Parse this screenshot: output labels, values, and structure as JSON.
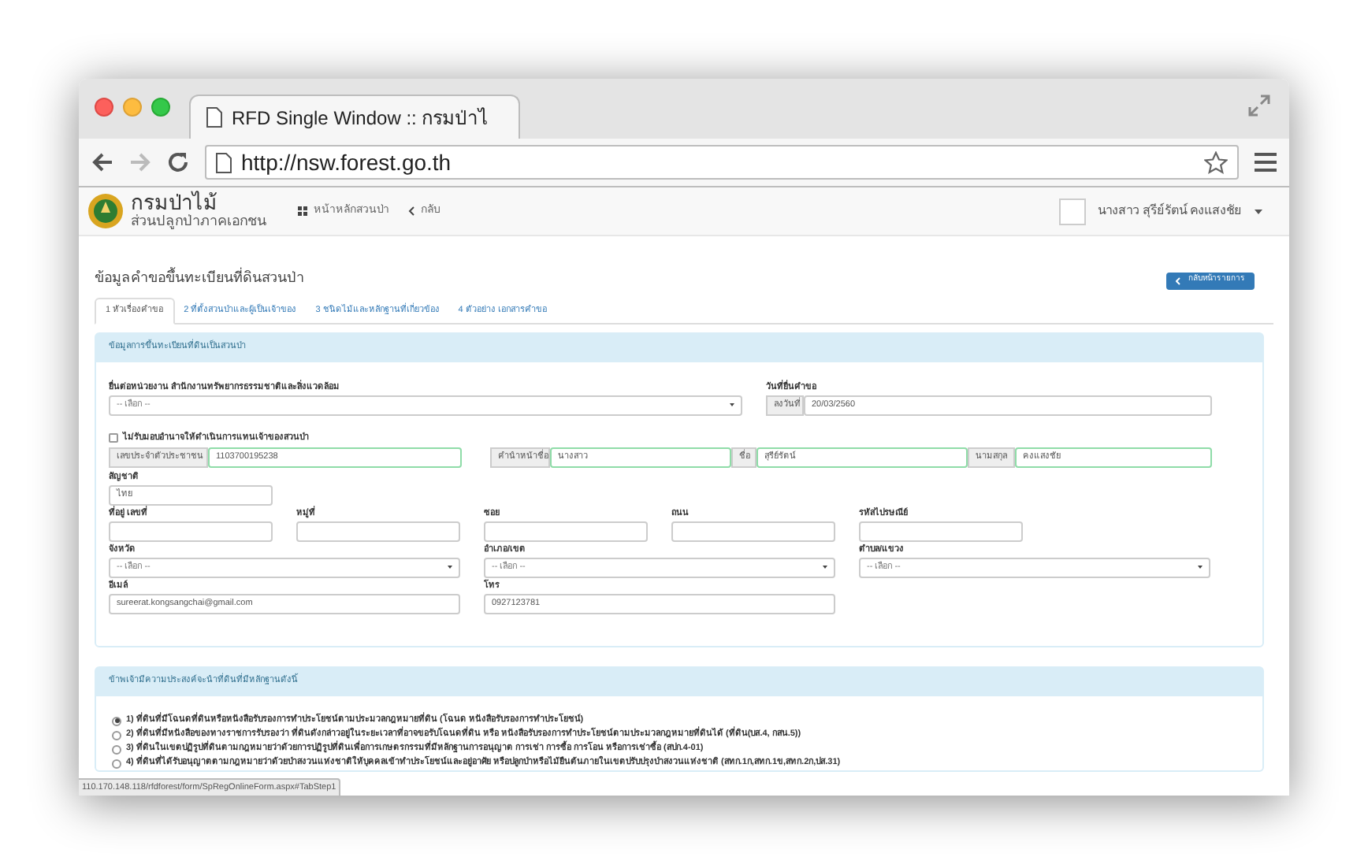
{
  "browser": {
    "tab_title": "RFD Single Window :: กรมป่าไ",
    "url": "http://nsw.forest.go.th"
  },
  "navbar": {
    "org_name": "กรมป่าไม้",
    "org_subtitle": "ส่วนปลูกป่าภาคเอกชน",
    "links": [
      "หน้าหลักสวนป่า",
      "กลับ"
    ],
    "user_name": "นางสาว สุรีย์รัตน์ คงแสงชัย"
  },
  "page": {
    "heading": "ข้อมูลคำขอขึ้นทะเบียนที่ดินสวนป่า",
    "back_button": "กลับหน้ารายการ"
  },
  "tabs": [
    {
      "label": "1 หัวเรื่องคำขอ",
      "selected": true
    },
    {
      "label": "2 ที่ตั้งสวนป่าและผู้เป็นเจ้าของ",
      "selected": false
    },
    {
      "label": "3 ชนิดไม้และหลักฐานที่เกี่ยวข้อง",
      "selected": false
    },
    {
      "label": "4 ตัวอย่าง เอกสารคำขอ",
      "selected": false
    }
  ],
  "registration_panel": {
    "title": "ข้อมูลการขึ้นทะเบียนที่ดินเป็นสวนป่า",
    "agency": {
      "label": "ยื่นต่อหน่วยงาน สำนักงานทรัพยากรธรรมชาติและสิ่งแวดล้อม",
      "value": "-- เลือก --"
    },
    "submit_date": {
      "label": "วันที่ยื่นคำขอ",
      "addon": "ลงวันที่",
      "value": "20/03/2560"
    },
    "proxy_checkbox": {
      "label": "ไม่รับมอบอำนาจให้ดำเนินการแทนเจ้าของสวนป่า",
      "checked": false
    },
    "identity": [
      {
        "addon": "เลขประจำตัวประชาชน",
        "value": "1103700195238",
        "valid": true
      },
      {
        "addon": "คำนำหน้าชื่อ",
        "value": "นางสาว",
        "valid": true
      },
      {
        "addon": "ชื่อ",
        "value": "สุรีย์รัตน์",
        "valid": true
      },
      {
        "addon": "นามสกุล",
        "value": "คงแสงชัย",
        "valid": true
      }
    ],
    "nationality": {
      "label": "สัญชาติ",
      "value": "ไทย"
    },
    "address": [
      {
        "label": "ที่อยู่ เลขที่"
      },
      {
        "label": "หมู่ที่"
      },
      {
        "label": "ซอย"
      },
      {
        "label": "ถนน"
      },
      {
        "label": "รหัสไปรษณีย์"
      }
    ],
    "location": [
      {
        "label": "จังหวัด",
        "value": "-- เลือก --"
      },
      {
        "label": "อำเภอ/เขต",
        "value": "-- เลือก --"
      },
      {
        "label": "ตำบล/แขวง",
        "value": "-- เลือก --"
      }
    ],
    "contact": [
      {
        "label": "อีเมล์",
        "value": "sureerat.kongsangchai@gmail.com"
      },
      {
        "label": "โทร",
        "value": "0927123781"
      }
    ]
  },
  "evidence_panel": {
    "title": "ข้าพเจ้ามีความประสงค์จะนำที่ดินที่มีหลักฐานดังนี้",
    "options": [
      {
        "label": "1) ที่ดินที่มีโฉนดที่ดินหรือหนังสือรับรองการทำประโยชน์ตามประมวลกฎหมายที่ดิน (โฉนด หนังสือรับรองการทำประโยชน์)",
        "selected": true
      },
      {
        "label": "2) ที่ดินที่มีหนังสือของทางราชการรับรองว่า ที่ดินดังกล่าวอยู่ในระยะเวลาที่อาจขอรับโฉนดที่ดิน หรือ หนังสือรับรองการทำประโยชน์ตามประมวลกฎหมายที่ดินได้ (ที่ดิน(บส.4, กสน.5))",
        "selected": false
      },
      {
        "label": "3) ที่ดินในเขตปฏิรูปที่ดินตามกฎหมายว่าด้วยการปฏิรูปที่ดินเพื่อการเกษตรกรรมที่มีหลักฐานการอนุญาต การเช่า การซื้อ การโอน หรือการเช่าซื้อ (สปก.4-01)",
        "selected": false
      },
      {
        "label": "4) ที่ดินที่ได้รับอนุญาตตามกฎหมายว่าด้วยป่าสงวนแห่งชาติให้บุคคลเข้าทำประโยชน์และอยู่อาศัย หรือปลูกป่าหรือไม้ยืนต้นภายในเขตปรับปรุงป่าสงวนแห่งชาติ (สทก.1ก,สทก.1ข,สทก.2ก,ปส.31)",
        "selected": false
      }
    ]
  },
  "status_bar": "110.170.148.118/rfdforest/form/SpRegOnlineForm.aspx#TabStep1"
}
